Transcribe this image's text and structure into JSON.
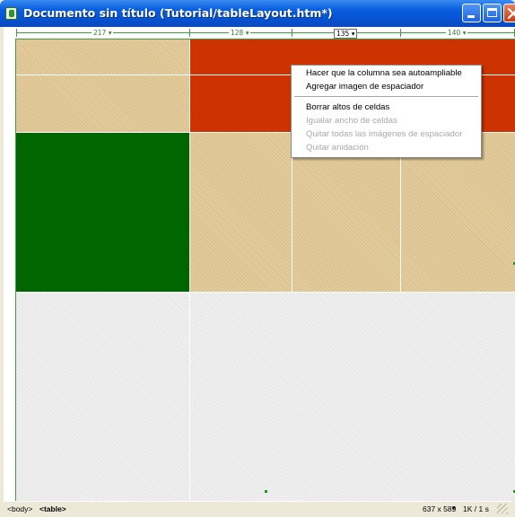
{
  "window": {
    "title": "Documento sin título (Tutorial/tableLayout.htm*)",
    "icon": "dreamweaver-document-icon",
    "controls": [
      "minimize-icon",
      "maximize-icon",
      "close-icon"
    ]
  },
  "ruler": {
    "columns": [
      {
        "label": "217 ▾"
      },
      {
        "label": "128 ▾"
      },
      {
        "label": "135 ▾",
        "selected": true
      },
      {
        "label": "140 ▾"
      }
    ]
  },
  "cells": {
    "colors": {
      "tan": "#d8be8c",
      "red": "#cc3300",
      "green": "#006600",
      "grey": "#eeeeee",
      "guide": "#3aa33a"
    }
  },
  "context_menu": {
    "items": [
      {
        "label": "Hacer que la columna sea autoampliable",
        "enabled": true
      },
      {
        "label": "Agregar imagen de espaciador",
        "enabled": true
      },
      {
        "label": "Borrar altos de celdas",
        "enabled": true
      },
      {
        "label": "Igualar ancho de celdas",
        "enabled": false
      },
      {
        "label": "Quitar todas las imágenes de espaciador",
        "enabled": false
      },
      {
        "label": "Quitar anidación",
        "enabled": false
      }
    ]
  },
  "status_bar": {
    "tag_body": "<body>",
    "tag_table": "<table>",
    "window_size": "637 x 589",
    "size_arrow": "▾",
    "download": "1K / 1 s"
  }
}
